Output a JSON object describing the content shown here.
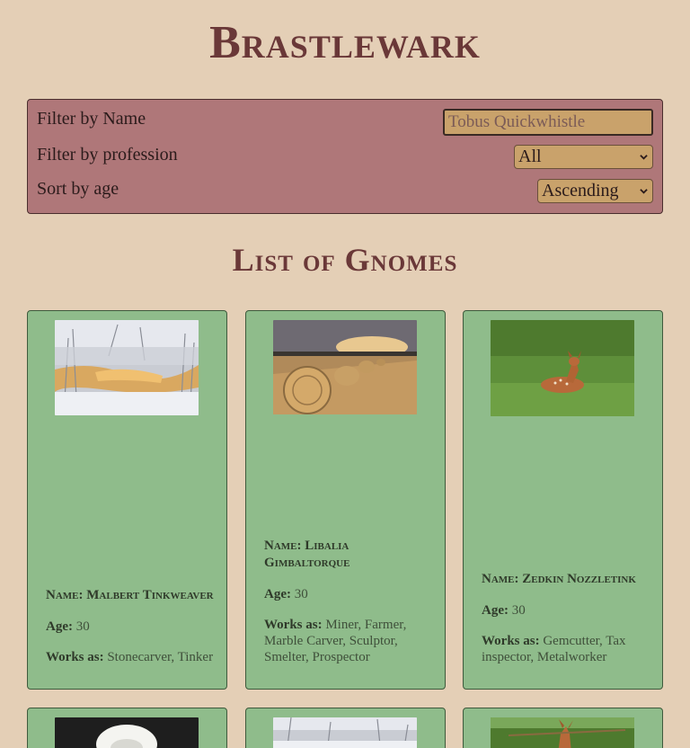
{
  "app": {
    "title": "Brastlewark"
  },
  "filters": {
    "name_label": "Filter by Name",
    "name_placeholder": "Tobus Quickwhistle",
    "profession_label": "Filter by profession",
    "profession_selected": "All",
    "sort_label": "Sort by age",
    "sort_selected": "Ascending"
  },
  "list": {
    "title": "List of Gnomes",
    "name_prefix": "Name:",
    "age_label": "Age:",
    "works_label": "Works as:",
    "gnomes": [
      {
        "name": "Malbert Tinkweaver",
        "age": "30",
        "professions": "Stonecarver, Tinker",
        "image": "snowy-creek-photo"
      },
      {
        "name": "Libalia Gimbaltorque",
        "age": "30",
        "professions": "Miner, Farmer, Marble Carver, Sculptor, Smelter, Prospector",
        "image": "hay-bales-photo"
      },
      {
        "name": "Zedkin Nozzletink",
        "age": "30",
        "professions": "Gemcutter, Tax inspector, Metalworker",
        "image": "fawn-in-grass-photo"
      }
    ]
  },
  "colors": {
    "background": "#e4cfb6",
    "title": "#6a3838",
    "filter_panel": "#af7779",
    "control": "#c9a26b",
    "card": "#8fbc8b"
  }
}
